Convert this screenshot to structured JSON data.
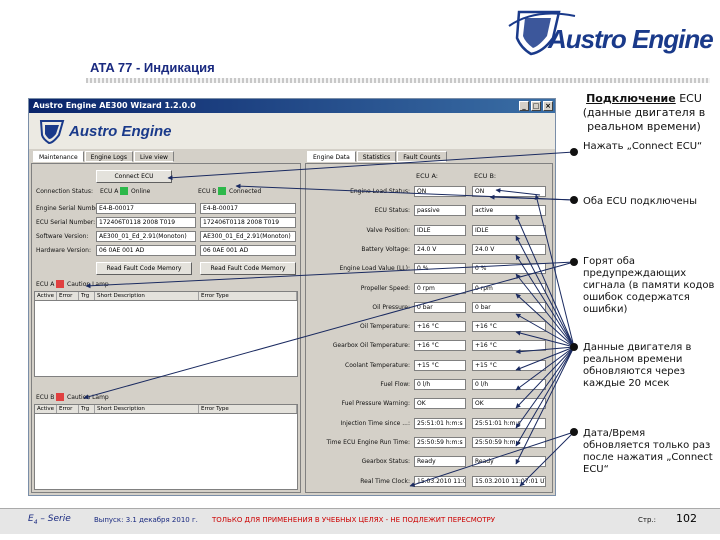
{
  "brand": {
    "logo_text": "Austro Engine"
  },
  "slide": {
    "title": "ATA 77 - Индикация"
  },
  "header": {
    "title": "Подключение",
    "title_suffix": "ECU",
    "subtitle": "(данные двигателя в реальном времени)"
  },
  "app": {
    "window_title": "Austro Engine AE300 Wizard 1.2.0.0",
    "logo_text": "Austro Engine",
    "left_tabs": [
      "Maintenance",
      "Engine Logs",
      "Live view"
    ],
    "right_tabs": [
      "Engine Data",
      "Statistics",
      "Fault Counts"
    ],
    "connect_label": "Connect ECU",
    "connection_status_label": "Connection Status:",
    "ecu_a_label": "ECU A",
    "ecu_a_status": "Online",
    "ecu_b_label": "ECU B",
    "ecu_b_status": "Connected",
    "info_rows": [
      {
        "label": "Engine Serial Number:",
        "a": "E4-B-00017",
        "b": "E4-B-00017"
      },
      {
        "label": "ECU Serial Number:",
        "a": "172406T0118 2008 T019",
        "b": "172406T0118 2008 T019"
      },
      {
        "label": "Software Version:",
        "a": "AE300_01_Ed_2.91(Monoton)",
        "b": "AE300_01_Ed_2.91(Monoton)"
      },
      {
        "label": "Hardware Version:",
        "a": "06 0AE 001 AD",
        "b": "06 0AE 001 AD"
      }
    ],
    "read_fault_a": "Read Fault Code Memory",
    "read_fault_b": "Read Fault Code Memory",
    "fault_a": {
      "label": "ECU A",
      "lamp": "Caution Lamp",
      "columns": [
        "Active",
        "Error",
        "Trg",
        "Short Description",
        "Error Type"
      ]
    },
    "fault_b": {
      "label": "ECU B",
      "lamp": "Caution Lamp",
      "columns": [
        "Active",
        "Error",
        "Trg",
        "Short Description",
        "Error Type"
      ]
    },
    "engine_data": {
      "col_a": "ECU A:",
      "col_b": "ECU B:",
      "rows": [
        {
          "label": "Engine Load Status:",
          "a": "ON",
          "b": "ON"
        },
        {
          "label": "ECU Status:",
          "a": "passive",
          "b": "active"
        },
        {
          "label": "Valve Position:",
          "a": "IDLE",
          "b": "IDLE"
        },
        {
          "label": "Battery Voltage:",
          "a": "24.0 V",
          "b": "24.0 V"
        },
        {
          "label": "Engine Load Value (LL):",
          "a": "0 %",
          "b": "0 %"
        },
        {
          "label": "Propeller Speed:",
          "a": "0 rpm",
          "b": "0 rpm"
        },
        {
          "label": "Oil Pressure:",
          "a": "0 bar",
          "b": "0 bar"
        },
        {
          "label": "Oil Temperature:",
          "a": "+16 °C",
          "b": "+16 °C"
        },
        {
          "label": "Gearbox Oil Temperature:",
          "a": "+16 °C",
          "b": "+16 °C"
        },
        {
          "label": "Coolant Temperature:",
          "a": "+15 °C",
          "b": "+15 °C"
        },
        {
          "label": "Fuel Flow:",
          "a": "0 l/h",
          "b": "0 l/h"
        },
        {
          "label": "Fuel Pressure Warning:",
          "a": "OK",
          "b": "OK"
        },
        {
          "label": "Injection Time since ...:",
          "a": "25:51:01 h:m:s",
          "b": "25:51:01 h:m:s"
        },
        {
          "label": "Time ECU Engine Run Time:",
          "a": "25:50:59 h:m:s",
          "b": "25:50:59 h:m:s"
        },
        {
          "label": "Gearbox Status:",
          "a": "Ready",
          "b": "Ready"
        },
        {
          "label": "Real Time Clock:",
          "a": "15.03.2010 11:07:01 UTC",
          "b": "15.03.2010 11:07:01 UTC"
        }
      ]
    }
  },
  "notes": [
    "Нажать „Connect ECU“",
    "Оба ECU подключены",
    "Горят оба предупреждающих сигнала (в памяти кодов ошибок содержатся ошибки)",
    "Данные двигателя в реальном времени обновляются через каждые 20 мсек",
    "Дата/Время обновляется только раз после нажатия „Connect ECU“"
  ],
  "footer": {
    "series_prefix": "E",
    "series_sub": "4",
    "series_suffix": " – Serie",
    "issue": "Выпуск: 3.1 декабря 2010 г.",
    "notice": "ТОЛЬКО ДЛЯ ПРИМЕНЕНИЯ В УЧЕБНЫХ ЦЕЛЯХ  - НЕ ПОДЛЕЖИТ ПЕРЕСМОТРУ",
    "page_label": "Стр.:",
    "page_number": "102"
  },
  "colors": {
    "brand_blue": "#1a3a8a",
    "indicator_green": "#2db84a",
    "indicator_red": "#e04040",
    "notice_red": "#cc0000",
    "arrow": "#1a2a60"
  }
}
